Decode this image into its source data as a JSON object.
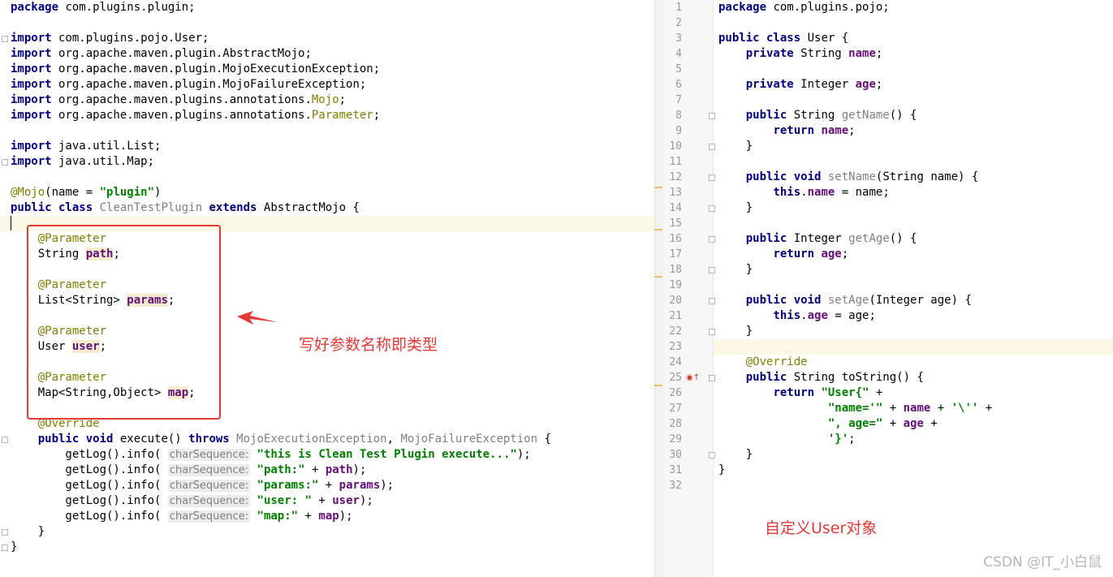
{
  "left_editor": {
    "lines": [
      [
        {
          "t": "package",
          "c": "kw"
        },
        {
          "t": " com.plugins.plugin;"
        }
      ],
      [],
      [
        {
          "t": "import",
          "c": "kw"
        },
        {
          "t": " com.plugins.pojo.User;"
        }
      ],
      [
        {
          "t": "import",
          "c": "kw"
        },
        {
          "t": " org.apache.maven.plugin.AbstractMojo;"
        }
      ],
      [
        {
          "t": "import",
          "c": "kw"
        },
        {
          "t": " org.apache.maven.plugin.MojoExecutionException;"
        }
      ],
      [
        {
          "t": "import",
          "c": "kw"
        },
        {
          "t": " org.apache.maven.plugin.MojoFailureException;"
        }
      ],
      [
        {
          "t": "import",
          "c": "kw"
        },
        {
          "t": " org.apache.maven.plugins.annotations."
        },
        {
          "t": "Mojo",
          "c": "ann"
        },
        {
          "t": ";"
        }
      ],
      [
        {
          "t": "import",
          "c": "kw"
        },
        {
          "t": " org.apache.maven.plugins.annotations."
        },
        {
          "t": "Parameter",
          "c": "ann"
        },
        {
          "t": ";"
        }
      ],
      [],
      [
        {
          "t": "import",
          "c": "kw"
        },
        {
          "t": " java.util.List;"
        }
      ],
      [
        {
          "t": "import",
          "c": "kw"
        },
        {
          "t": " java.util.Map;"
        }
      ],
      [],
      [
        {
          "t": "@Mojo",
          "c": "ann"
        },
        {
          "t": "(name = "
        },
        {
          "t": "\"plugin\"",
          "c": "str"
        },
        {
          "t": ")"
        }
      ],
      [
        {
          "t": "public class",
          "c": "kw"
        },
        {
          "t": " "
        },
        {
          "t": "CleanTestPlugin",
          "c": "grey"
        },
        {
          "t": " "
        },
        {
          "t": "extends",
          "c": "kw"
        },
        {
          "t": " AbstractMojo {"
        }
      ],
      [],
      [
        {
          "t": "    "
        },
        {
          "t": "@Parameter",
          "c": "ann"
        }
      ],
      [
        {
          "t": "    String "
        },
        {
          "t": "path",
          "c": "fld fieldhl"
        },
        {
          "t": ";"
        }
      ],
      [],
      [
        {
          "t": "    "
        },
        {
          "t": "@Parameter",
          "c": "ann"
        }
      ],
      [
        {
          "t": "    List<String> "
        },
        {
          "t": "params",
          "c": "fld fieldhl"
        },
        {
          "t": ";"
        }
      ],
      [],
      [
        {
          "t": "    "
        },
        {
          "t": "@Parameter",
          "c": "ann"
        }
      ],
      [
        {
          "t": "    User "
        },
        {
          "t": "user",
          "c": "fld fieldhl"
        },
        {
          "t": ";"
        }
      ],
      [],
      [
        {
          "t": "    "
        },
        {
          "t": "@Parameter",
          "c": "ann"
        }
      ],
      [
        {
          "t": "    Map<String,Object> "
        },
        {
          "t": "map",
          "c": "fld fieldhl"
        },
        {
          "t": ";"
        }
      ],
      [],
      [
        {
          "t": "    "
        },
        {
          "t": "@Override",
          "c": "ann"
        }
      ],
      [
        {
          "t": "    "
        },
        {
          "t": "public void",
          "c": "kw"
        },
        {
          "t": " execute() "
        },
        {
          "t": "throws",
          "c": "kw"
        },
        {
          "t": " "
        },
        {
          "t": "MojoExecutionException",
          "c": "grey"
        },
        {
          "t": ", "
        },
        {
          "t": "MojoFailureException",
          "c": "grey"
        },
        {
          "t": " {"
        }
      ],
      [
        {
          "t": "        getLog().info( "
        },
        {
          "t": "charSequence:",
          "c": "hint"
        },
        {
          "t": " "
        },
        {
          "t": "\"this is Clean Test Plugin execute...\"",
          "c": "str"
        },
        {
          "t": ");"
        }
      ],
      [
        {
          "t": "        getLog().info( "
        },
        {
          "t": "charSequence:",
          "c": "hint"
        },
        {
          "t": " "
        },
        {
          "t": "\"path:\"",
          "c": "str"
        },
        {
          "t": " + "
        },
        {
          "t": "path",
          "c": "fld"
        },
        {
          "t": ");"
        }
      ],
      [
        {
          "t": "        getLog().info( "
        },
        {
          "t": "charSequence:",
          "c": "hint"
        },
        {
          "t": " "
        },
        {
          "t": "\"params:\"",
          "c": "str"
        },
        {
          "t": " + "
        },
        {
          "t": "params",
          "c": "fld"
        },
        {
          "t": ");"
        }
      ],
      [
        {
          "t": "        getLog().info( "
        },
        {
          "t": "charSequence:",
          "c": "hint"
        },
        {
          "t": " "
        },
        {
          "t": "\"user: \"",
          "c": "str"
        },
        {
          "t": " + "
        },
        {
          "t": "user",
          "c": "fld"
        },
        {
          "t": ");"
        }
      ],
      [
        {
          "t": "        getLog().info( "
        },
        {
          "t": "charSequence:",
          "c": "hint"
        },
        {
          "t": " "
        },
        {
          "t": "\"map:\"",
          "c": "str"
        },
        {
          "t": " + "
        },
        {
          "t": "map",
          "c": "fld"
        },
        {
          "t": ");"
        }
      ],
      [
        {
          "t": "    }"
        }
      ],
      [
        {
          "t": "}"
        }
      ]
    ]
  },
  "right_editor": {
    "line_numbers": [
      "1",
      "2",
      "3",
      "4",
      "5",
      "6",
      "7",
      "8",
      "9",
      "10",
      "11",
      "12",
      "13",
      "14",
      "15",
      "16",
      "17",
      "18",
      "19",
      "20",
      "21",
      "22",
      "23",
      "24",
      "25",
      "26",
      "27",
      "28",
      "29",
      "30",
      "31",
      "32"
    ],
    "lines": [
      [
        {
          "t": "package",
          "c": "kw"
        },
        {
          "t": " com.plugins.pojo;"
        }
      ],
      [],
      [
        {
          "t": "public class",
          "c": "kw"
        },
        {
          "t": " User {"
        }
      ],
      [
        {
          "t": "    "
        },
        {
          "t": "private",
          "c": "kw"
        },
        {
          "t": " String "
        },
        {
          "t": "name",
          "c": "fld"
        },
        {
          "t": ";"
        }
      ],
      [],
      [
        {
          "t": "    "
        },
        {
          "t": "private",
          "c": "kw"
        },
        {
          "t": " Integer "
        },
        {
          "t": "age",
          "c": "fld"
        },
        {
          "t": ";"
        }
      ],
      [],
      [
        {
          "t": "    "
        },
        {
          "t": "public",
          "c": "kw"
        },
        {
          "t": " String "
        },
        {
          "t": "getName",
          "c": "grey"
        },
        {
          "t": "() {"
        }
      ],
      [
        {
          "t": "        "
        },
        {
          "t": "return",
          "c": "kw"
        },
        {
          "t": " "
        },
        {
          "t": "name",
          "c": "fld"
        },
        {
          "t": ";"
        }
      ],
      [
        {
          "t": "    }"
        }
      ],
      [],
      [
        {
          "t": "    "
        },
        {
          "t": "public void",
          "c": "kw"
        },
        {
          "t": " "
        },
        {
          "t": "setName",
          "c": "grey"
        },
        {
          "t": "(String name) {"
        }
      ],
      [
        {
          "t": "        "
        },
        {
          "t": "this",
          "c": "kw"
        },
        {
          "t": "."
        },
        {
          "t": "name",
          "c": "fld"
        },
        {
          "t": " = name;"
        }
      ],
      [
        {
          "t": "    }"
        }
      ],
      [],
      [
        {
          "t": "    "
        },
        {
          "t": "public",
          "c": "kw"
        },
        {
          "t": " Integer "
        },
        {
          "t": "getAge",
          "c": "grey"
        },
        {
          "t": "() {"
        }
      ],
      [
        {
          "t": "        "
        },
        {
          "t": "return",
          "c": "kw"
        },
        {
          "t": " "
        },
        {
          "t": "age",
          "c": "fld"
        },
        {
          "t": ";"
        }
      ],
      [
        {
          "t": "    }"
        }
      ],
      [],
      [
        {
          "t": "    "
        },
        {
          "t": "public void",
          "c": "kw"
        },
        {
          "t": " "
        },
        {
          "t": "setAge",
          "c": "grey"
        },
        {
          "t": "(Integer age) {"
        }
      ],
      [
        {
          "t": "        "
        },
        {
          "t": "this",
          "c": "kw"
        },
        {
          "t": "."
        },
        {
          "t": "age",
          "c": "fld"
        },
        {
          "t": " = age;"
        }
      ],
      [
        {
          "t": "    }"
        }
      ],
      [],
      [
        {
          "t": "    "
        },
        {
          "t": "@Override",
          "c": "ann"
        }
      ],
      [
        {
          "t": "    "
        },
        {
          "t": "public",
          "c": "kw"
        },
        {
          "t": " String toString() {"
        }
      ],
      [
        {
          "t": "        "
        },
        {
          "t": "return",
          "c": "kw"
        },
        {
          "t": " "
        },
        {
          "t": "\"User{\"",
          "c": "str"
        },
        {
          "t": " +"
        }
      ],
      [
        {
          "t": "                "
        },
        {
          "t": "\"name='\"",
          "c": "str"
        },
        {
          "t": " + "
        },
        {
          "t": "name",
          "c": "fld"
        },
        {
          "t": " + "
        },
        {
          "t": "'\\''",
          "c": "str"
        },
        {
          "t": " +"
        }
      ],
      [
        {
          "t": "                "
        },
        {
          "t": "\", age=\"",
          "c": "str"
        },
        {
          "t": " + "
        },
        {
          "t": "age",
          "c": "fld"
        },
        {
          "t": " +"
        }
      ],
      [
        {
          "t": "                "
        },
        {
          "t": "'}'",
          "c": "str"
        },
        {
          "t": ";"
        }
      ],
      [
        {
          "t": "    }"
        }
      ],
      [
        {
          "t": "}"
        }
      ],
      []
    ]
  },
  "annotations": {
    "left_note": "写好参数名称即类型",
    "right_note": "自定义User对象"
  },
  "watermark": "CSDN @IT_小白鼠",
  "icons": {
    "scroll_toggle": "pause-icon",
    "override_marker": "override-gutter-icon",
    "arrow": "red-arrow-icon"
  },
  "colors": {
    "keyword": "#000080",
    "annotation": "#808000",
    "string": "#008000",
    "field": "#660e7a",
    "callout": "#e53935",
    "current_line": "#fbf9e6"
  }
}
